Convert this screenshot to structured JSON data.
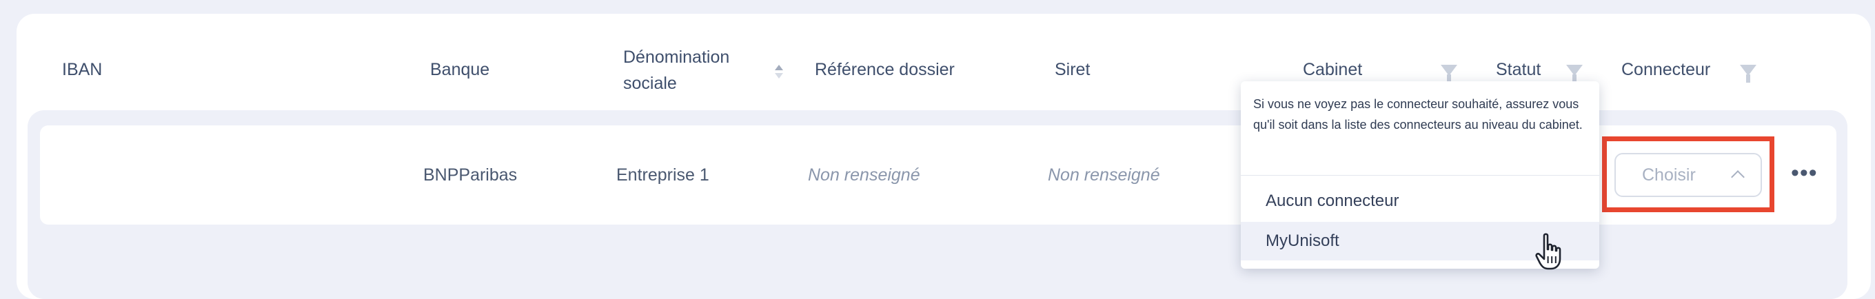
{
  "table": {
    "headers": {
      "iban": "IBAN",
      "banque": "Banque",
      "denomination_line1": "Dénomination",
      "denomination_line2": "sociale",
      "reference": "Référence dossier",
      "siret": "Siret",
      "cabinet": "Cabinet",
      "statut": "Statut",
      "connecteur": "Connecteur"
    },
    "rows": [
      {
        "iban": "",
        "banque": "BNPParibas",
        "denomination": "Entreprise 1",
        "reference": "Non renseigné",
        "siret": "Non renseigné"
      }
    ]
  },
  "connector_select": {
    "placeholder": "Choisir"
  },
  "dropdown": {
    "hint": "Si vous ne voyez pas le connecteur souhaité, assurez vous qu'il soit dans la liste des connecteurs au niveau du cabinet.",
    "options": [
      "Aucun connecteur",
      "MyUnisoft"
    ],
    "hovered": "MyUnisoft"
  },
  "row_actions": {
    "more_label": "•••"
  },
  "colors": {
    "background": "#eef0f8",
    "annotation": "#e8462f",
    "text": "#3f4f6c"
  }
}
